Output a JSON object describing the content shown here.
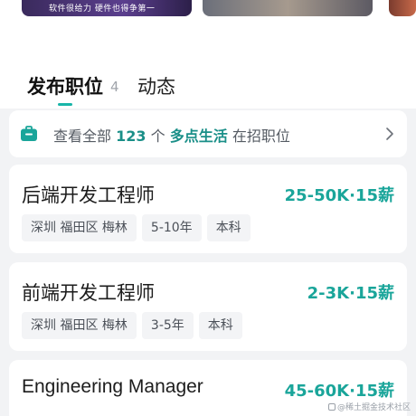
{
  "banner": {
    "caption": "软件很给力  硬件也得争第一"
  },
  "tabs": {
    "active_label": "发布职位",
    "active_count": "4",
    "second_label": "动态"
  },
  "summary": {
    "prefix": "查看全部",
    "count": "123",
    "unit": "个",
    "company": "多点生活",
    "suffix": "在招职位"
  },
  "jobs": [
    {
      "title": "后端开发工程师",
      "salary": "25-50K·15薪",
      "tags": [
        "深圳 福田区 梅林",
        "5-10年",
        "本科"
      ]
    },
    {
      "title": "前端开发工程师",
      "salary": "2-3K·15薪",
      "tags": [
        "深圳 福田区 梅林",
        "3-5年",
        "本科"
      ]
    },
    {
      "title": "Engineering Manager",
      "salary": "45-60K·15薪",
      "tags": []
    }
  ],
  "watermark": "@稀土掘金技术社区",
  "colors": {
    "accent": "#1aa59a",
    "tab_underline": "#18b5a8",
    "background": "#f2f3f5"
  },
  "icons": {
    "summary_icon": "briefcase-icon",
    "summary_arrow": "chevron-right-icon"
  }
}
